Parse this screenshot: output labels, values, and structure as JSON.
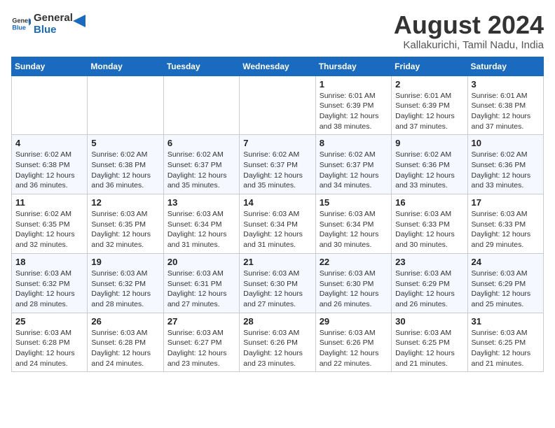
{
  "header": {
    "logo_general": "General",
    "logo_blue": "Blue",
    "main_title": "August 2024",
    "subtitle": "Kallakurichi, Tamil Nadu, India"
  },
  "weekdays": [
    "Sunday",
    "Monday",
    "Tuesday",
    "Wednesday",
    "Thursday",
    "Friday",
    "Saturday"
  ],
  "weeks": [
    [
      {
        "day": "",
        "info": ""
      },
      {
        "day": "",
        "info": ""
      },
      {
        "day": "",
        "info": ""
      },
      {
        "day": "",
        "info": ""
      },
      {
        "day": "1",
        "info": "Sunrise: 6:01 AM\nSunset: 6:39 PM\nDaylight: 12 hours\nand 38 minutes."
      },
      {
        "day": "2",
        "info": "Sunrise: 6:01 AM\nSunset: 6:39 PM\nDaylight: 12 hours\nand 37 minutes."
      },
      {
        "day": "3",
        "info": "Sunrise: 6:01 AM\nSunset: 6:38 PM\nDaylight: 12 hours\nand 37 minutes."
      }
    ],
    [
      {
        "day": "4",
        "info": "Sunrise: 6:02 AM\nSunset: 6:38 PM\nDaylight: 12 hours\nand 36 minutes."
      },
      {
        "day": "5",
        "info": "Sunrise: 6:02 AM\nSunset: 6:38 PM\nDaylight: 12 hours\nand 36 minutes."
      },
      {
        "day": "6",
        "info": "Sunrise: 6:02 AM\nSunset: 6:37 PM\nDaylight: 12 hours\nand 35 minutes."
      },
      {
        "day": "7",
        "info": "Sunrise: 6:02 AM\nSunset: 6:37 PM\nDaylight: 12 hours\nand 35 minutes."
      },
      {
        "day": "8",
        "info": "Sunrise: 6:02 AM\nSunset: 6:37 PM\nDaylight: 12 hours\nand 34 minutes."
      },
      {
        "day": "9",
        "info": "Sunrise: 6:02 AM\nSunset: 6:36 PM\nDaylight: 12 hours\nand 33 minutes."
      },
      {
        "day": "10",
        "info": "Sunrise: 6:02 AM\nSunset: 6:36 PM\nDaylight: 12 hours\nand 33 minutes."
      }
    ],
    [
      {
        "day": "11",
        "info": "Sunrise: 6:02 AM\nSunset: 6:35 PM\nDaylight: 12 hours\nand 32 minutes."
      },
      {
        "day": "12",
        "info": "Sunrise: 6:03 AM\nSunset: 6:35 PM\nDaylight: 12 hours\nand 32 minutes."
      },
      {
        "day": "13",
        "info": "Sunrise: 6:03 AM\nSunset: 6:34 PM\nDaylight: 12 hours\nand 31 minutes."
      },
      {
        "day": "14",
        "info": "Sunrise: 6:03 AM\nSunset: 6:34 PM\nDaylight: 12 hours\nand 31 minutes."
      },
      {
        "day": "15",
        "info": "Sunrise: 6:03 AM\nSunset: 6:34 PM\nDaylight: 12 hours\nand 30 minutes."
      },
      {
        "day": "16",
        "info": "Sunrise: 6:03 AM\nSunset: 6:33 PM\nDaylight: 12 hours\nand 30 minutes."
      },
      {
        "day": "17",
        "info": "Sunrise: 6:03 AM\nSunset: 6:33 PM\nDaylight: 12 hours\nand 29 minutes."
      }
    ],
    [
      {
        "day": "18",
        "info": "Sunrise: 6:03 AM\nSunset: 6:32 PM\nDaylight: 12 hours\nand 28 minutes."
      },
      {
        "day": "19",
        "info": "Sunrise: 6:03 AM\nSunset: 6:32 PM\nDaylight: 12 hours\nand 28 minutes."
      },
      {
        "day": "20",
        "info": "Sunrise: 6:03 AM\nSunset: 6:31 PM\nDaylight: 12 hours\nand 27 minutes."
      },
      {
        "day": "21",
        "info": "Sunrise: 6:03 AM\nSunset: 6:30 PM\nDaylight: 12 hours\nand 27 minutes."
      },
      {
        "day": "22",
        "info": "Sunrise: 6:03 AM\nSunset: 6:30 PM\nDaylight: 12 hours\nand 26 minutes."
      },
      {
        "day": "23",
        "info": "Sunrise: 6:03 AM\nSunset: 6:29 PM\nDaylight: 12 hours\nand 26 minutes."
      },
      {
        "day": "24",
        "info": "Sunrise: 6:03 AM\nSunset: 6:29 PM\nDaylight: 12 hours\nand 25 minutes."
      }
    ],
    [
      {
        "day": "25",
        "info": "Sunrise: 6:03 AM\nSunset: 6:28 PM\nDaylight: 12 hours\nand 24 minutes."
      },
      {
        "day": "26",
        "info": "Sunrise: 6:03 AM\nSunset: 6:28 PM\nDaylight: 12 hours\nand 24 minutes."
      },
      {
        "day": "27",
        "info": "Sunrise: 6:03 AM\nSunset: 6:27 PM\nDaylight: 12 hours\nand 23 minutes."
      },
      {
        "day": "28",
        "info": "Sunrise: 6:03 AM\nSunset: 6:26 PM\nDaylight: 12 hours\nand 23 minutes."
      },
      {
        "day": "29",
        "info": "Sunrise: 6:03 AM\nSunset: 6:26 PM\nDaylight: 12 hours\nand 22 minutes."
      },
      {
        "day": "30",
        "info": "Sunrise: 6:03 AM\nSunset: 6:25 PM\nDaylight: 12 hours\nand 21 minutes."
      },
      {
        "day": "31",
        "info": "Sunrise: 6:03 AM\nSunset: 6:25 PM\nDaylight: 12 hours\nand 21 minutes."
      }
    ]
  ]
}
